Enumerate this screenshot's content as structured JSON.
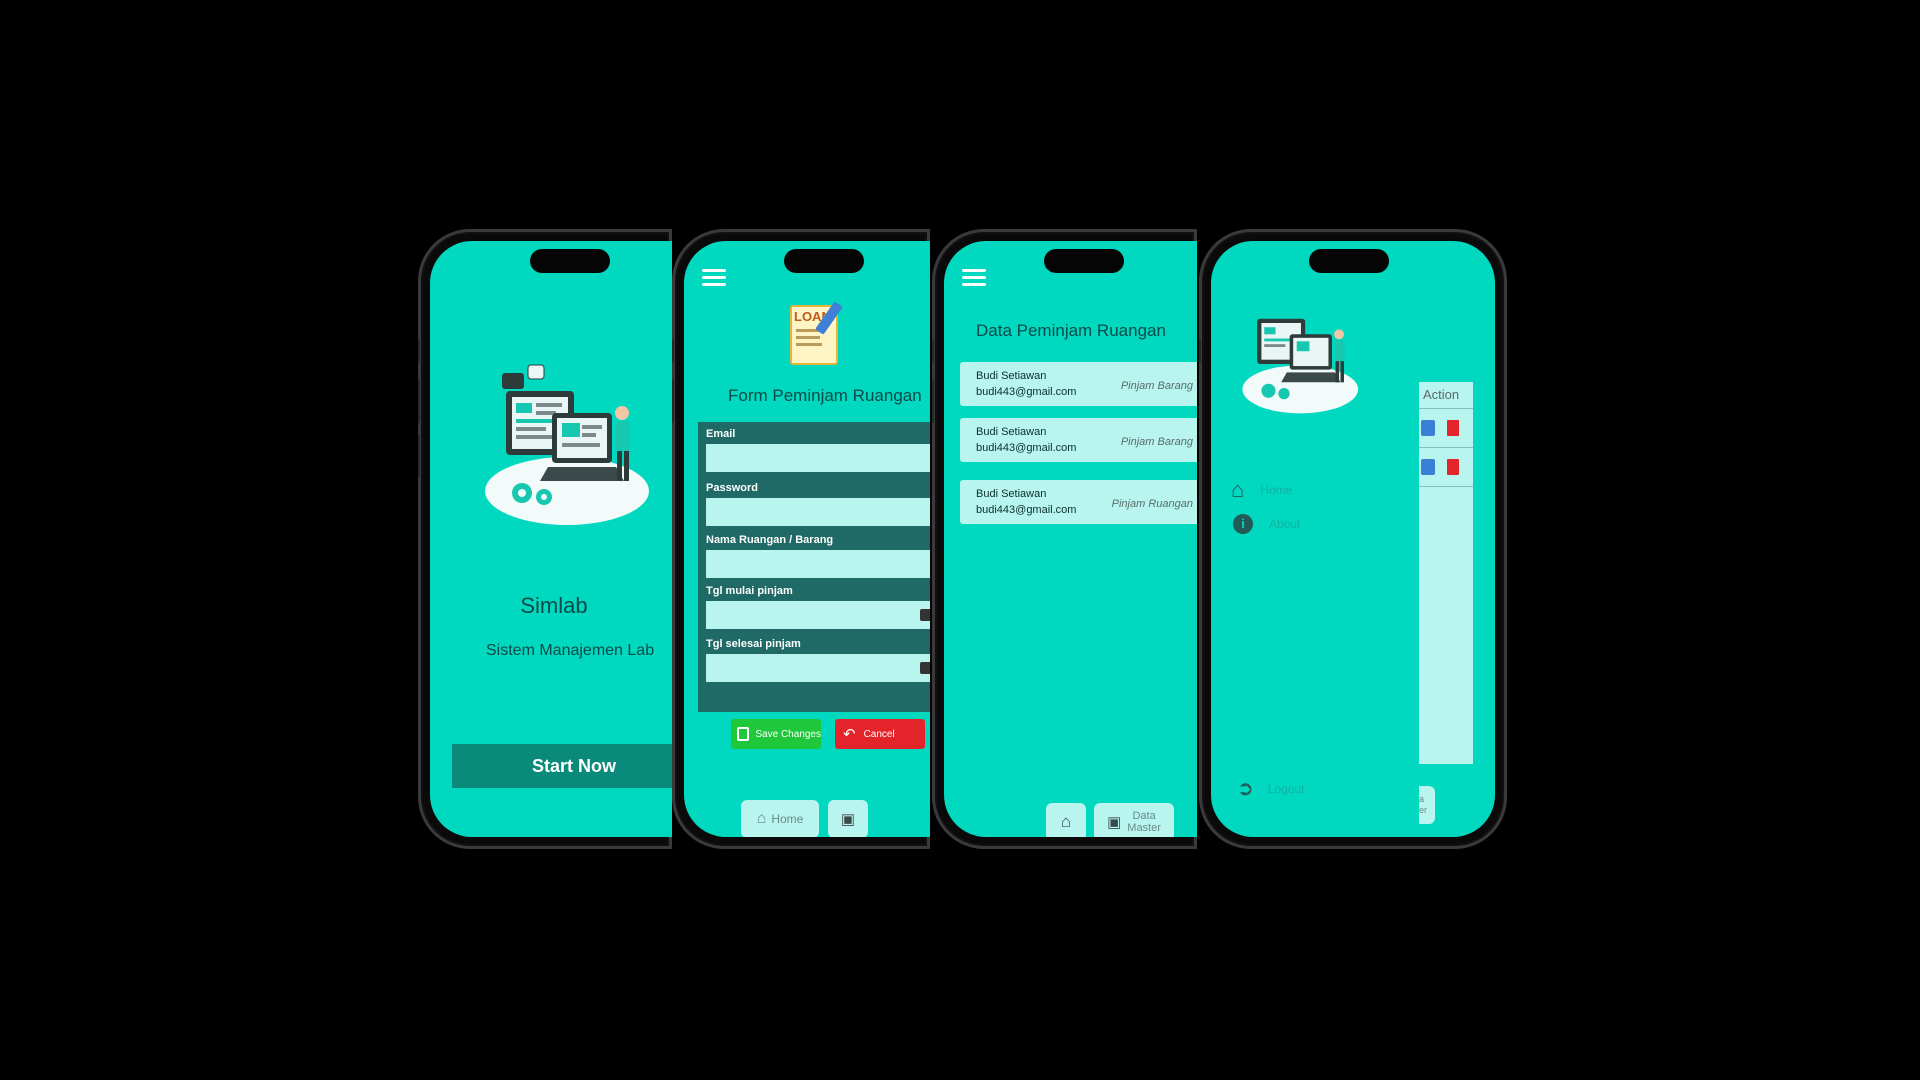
{
  "splash": {
    "app_name": "Simlab",
    "subtitle": "Sistem Manajemen Lab",
    "start_button": "Start Now"
  },
  "form": {
    "logo_text": "LOAN",
    "title": "Form Peminjam Ruangan",
    "fields": [
      {
        "label": "Email",
        "value": ""
      },
      {
        "label": "Password",
        "value": ""
      },
      {
        "label": "Nama Ruangan / Barang",
        "value": ""
      },
      {
        "label": "Tgl mulai pinjam",
        "value": ""
      },
      {
        "label": "Tgl selesai pinjam",
        "value": ""
      }
    ],
    "save_button": "Save Changes",
    "cancel_button": "Cancel",
    "nav_home": "Home"
  },
  "list": {
    "title": "Data Peminjam Ruangan",
    "items": [
      {
        "name": "Budi Setiawan",
        "email": "budi443@gmail.com",
        "type": "Pinjam Barang"
      },
      {
        "name": "Budi Setiawan",
        "email": "budi443@gmail.com",
        "type": "Pinjam Barang"
      },
      {
        "name": "Budi Setiawan",
        "email": "budi443@gmail.com",
        "type": "Pinjam Ruangan"
      }
    ],
    "nav_data_master_line1": "Data",
    "nav_data_master_line2": "Master"
  },
  "drawer": {
    "menu_home": "Home",
    "menu_about": "About",
    "logout": "Logout",
    "action_header": "Action",
    "peek_label_1": "a",
    "peek_label_2": "er"
  },
  "colors": {
    "screen_bg": "#00d9bf",
    "field_bg": "#b8f5ee",
    "save_green": "#1ec83a",
    "cancel_red": "#e3242b",
    "start_button": "#0a8a7a"
  }
}
